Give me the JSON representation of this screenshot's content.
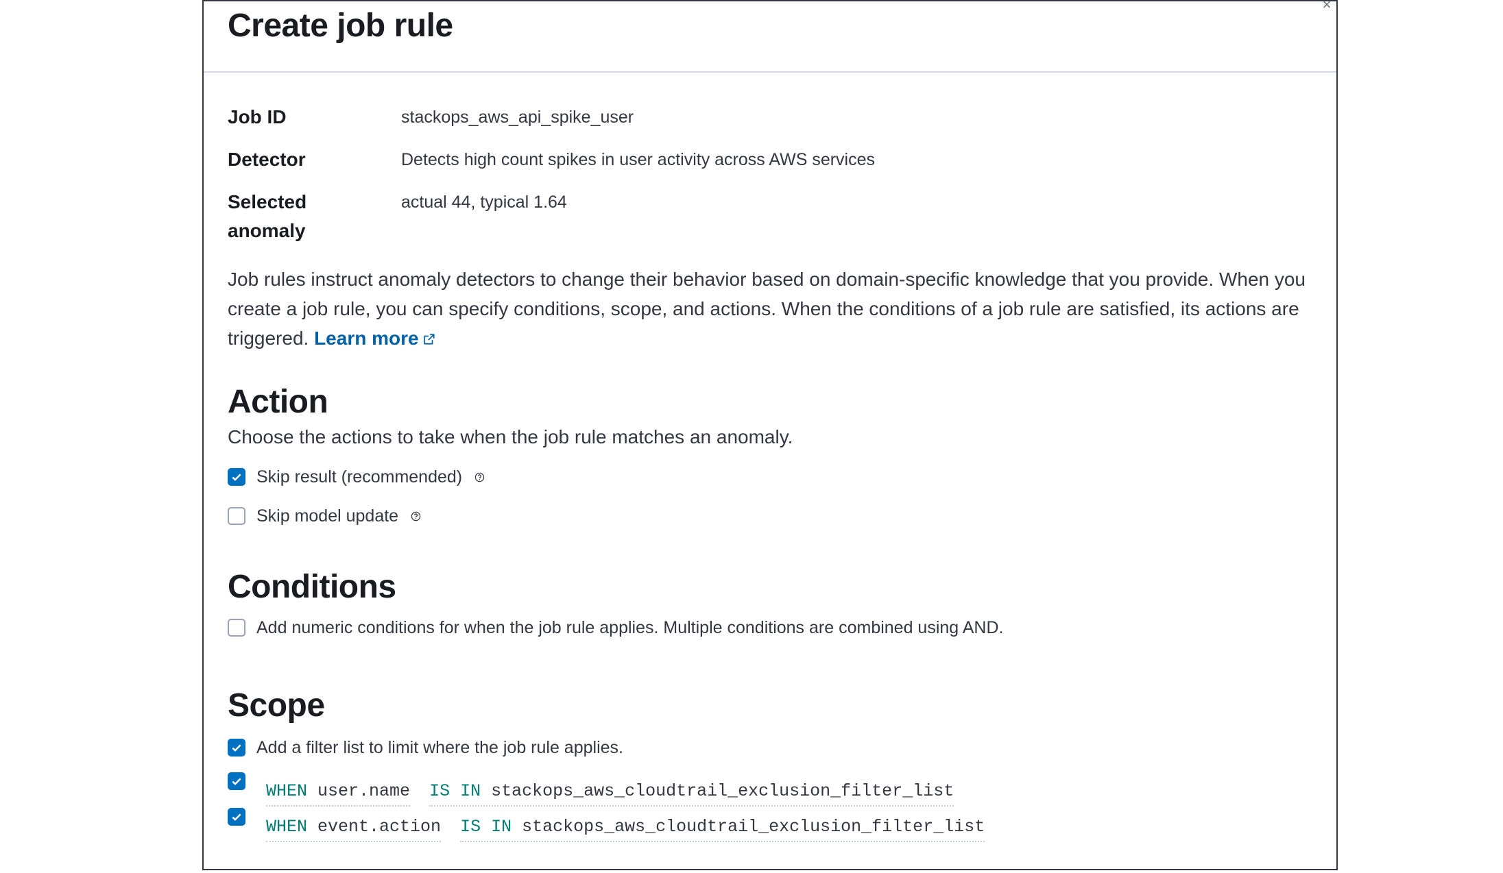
{
  "flyout": {
    "title": "Create job rule",
    "close_glyph": "×"
  },
  "details": [
    {
      "title": "Job ID",
      "value": "stackops_aws_api_spike_user"
    },
    {
      "title": "Detector",
      "value": "Detects high count spikes in user activity across AWS services"
    },
    {
      "title": "Selected anomaly",
      "value": "actual 44, typical 1.64"
    }
  ],
  "intro": {
    "text": "Job rules instruct anomaly detectors to change their behavior based on domain-specific knowledge that you provide. When you create a job rule, you can specify conditions, scope, and actions. When the conditions of a job rule are satisfied, its actions are triggered.",
    "link_label": "Learn more",
    "link_icon": "external-link-icon"
  },
  "action": {
    "title": "Action",
    "description": "Choose the actions to take when the job rule matches an anomaly.",
    "options": [
      {
        "label": "Skip result (recommended)",
        "checked": true,
        "icon": "question-tooltip-icon"
      },
      {
        "label": "Skip model update",
        "checked": false,
        "icon": "question-tooltip-icon"
      }
    ]
  },
  "conditions": {
    "title": "Conditions",
    "option_label": "Add numeric conditions for when the job rule applies. Multiple conditions are combined using AND.",
    "checked": false
  },
  "scope": {
    "title": "Scope",
    "option_label": "Add a filter list to limit where the job rule applies.",
    "checked": true,
    "rules": [
      {
        "when": "WHEN",
        "field": "user.name",
        "operator": "IS IN",
        "filter": "stackops_aws_cloudtrail_exclusion_filter_list",
        "checked": true
      },
      {
        "when": "WHEN",
        "field": "event.action",
        "operator": "IS IN",
        "filter": "stackops_aws_cloudtrail_exclusion_filter_list",
        "checked": true
      }
    ]
  },
  "colors": {
    "accent": "#0071c2",
    "link": "#0061a6",
    "keyword": "#017d73"
  }
}
